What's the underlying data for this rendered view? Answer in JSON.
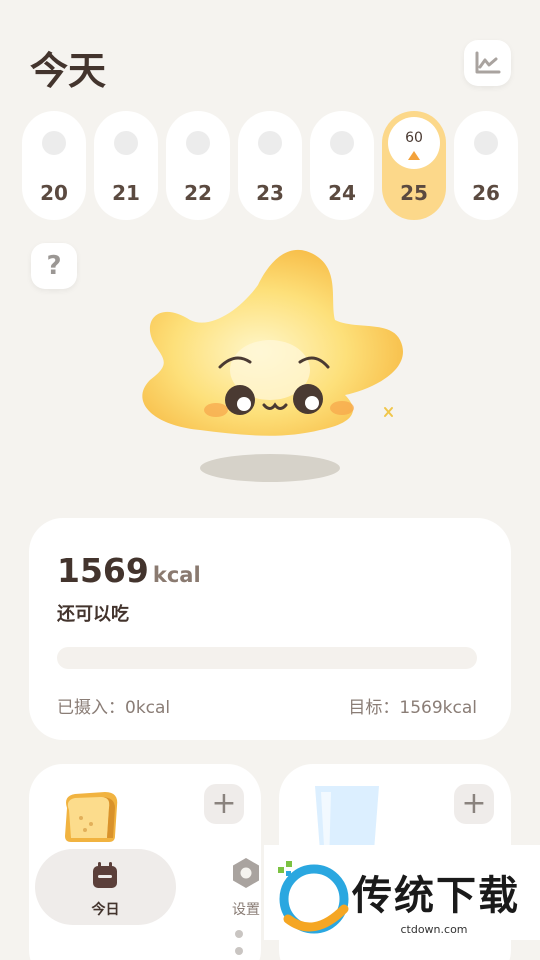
{
  "header": {
    "title": "今天"
  },
  "days": [
    {
      "label": "20"
    },
    {
      "label": "21"
    },
    {
      "label": "22"
    },
    {
      "label": "23"
    },
    {
      "label": "24"
    },
    {
      "label": "25",
      "selected": true,
      "badge": "60"
    },
    {
      "label": "26"
    }
  ],
  "summary": {
    "remaining_value": "1569",
    "remaining_unit": "kcal",
    "remaining_caption": "还可以吃",
    "progress": 0,
    "intake_text": "已摄入：0kcal",
    "goal_text": "目标：1569kcal"
  },
  "tabs": {
    "today": "今日",
    "settings": "设置"
  },
  "watermark": {
    "brand": "传统下载",
    "domain": "ctdown.com"
  },
  "colors": {
    "accent": "#fcd88a",
    "marker": "#f3a23c",
    "background": "#f5f3ef"
  }
}
